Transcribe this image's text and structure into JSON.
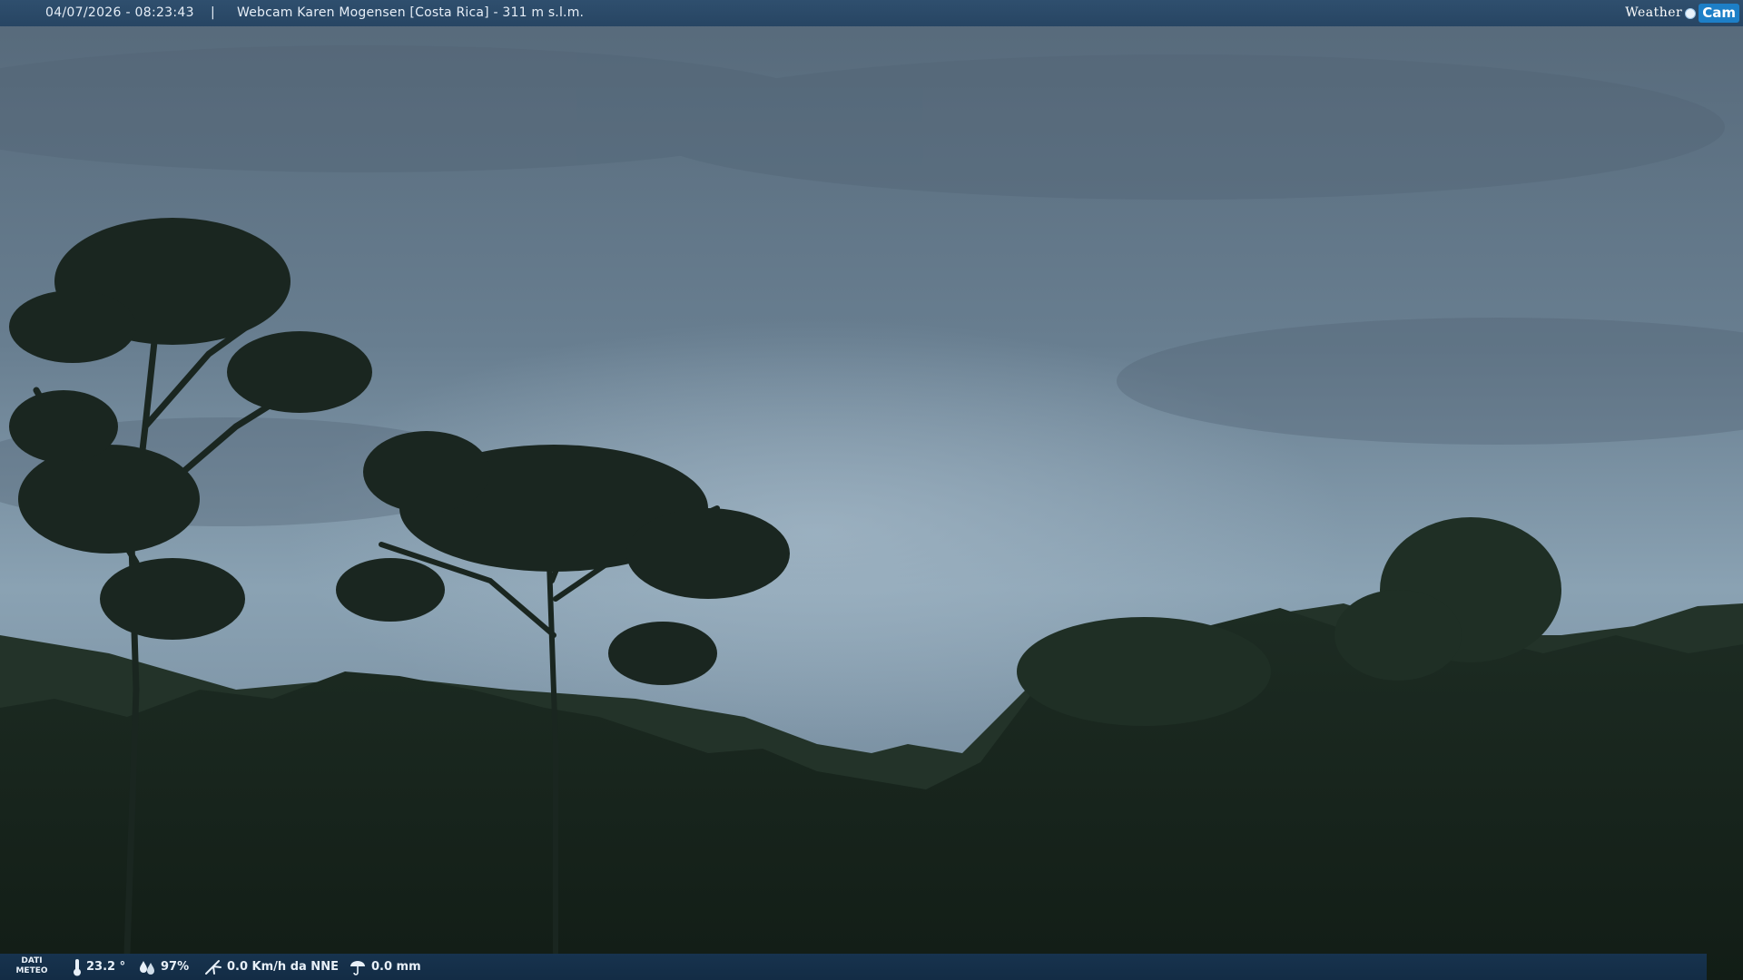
{
  "header": {
    "datetime": "04/07/2026 - 08:23:43",
    "separator": "|",
    "title": "Webcam Karen Mogensen [Costa Rica]  - 311 m s.l.m.",
    "brand_left": "Weather",
    "brand_right": "Cam"
  },
  "weather": {
    "label_line1": "DATI",
    "label_line2": "METEO",
    "temperature": "23.2 °",
    "humidity": "97%",
    "wind": "0.0 Km/h da NNE",
    "rain": "0.0 mm"
  },
  "icons": [
    "thermometer-icon",
    "humidity-icon",
    "wind-icon",
    "rain-icon",
    "brand-globe-icon"
  ],
  "colors": {
    "top_bar": "#2f4f6e",
    "bottom_bar": "#17334e",
    "sky": "#7f97a9",
    "foliage": "#1a2a20"
  }
}
